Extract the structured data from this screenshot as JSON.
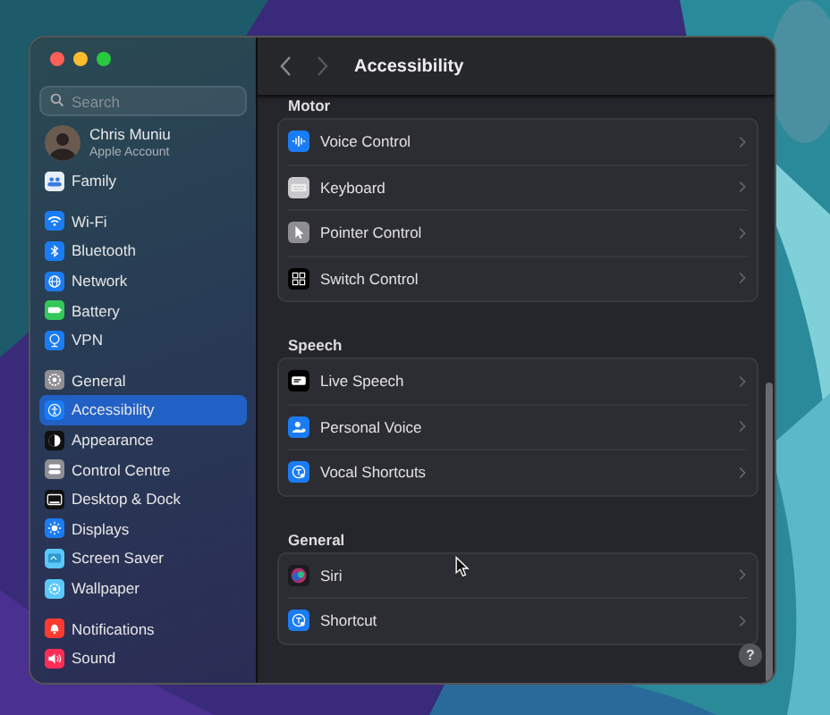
{
  "window": {
    "title": "Accessibility"
  },
  "sidebar": {
    "search": {
      "placeholder": "Search"
    },
    "account": {
      "name": "Chris Muniu",
      "subtitle": "Apple Account"
    },
    "groups": [
      {
        "items": [
          {
            "label": "Family",
            "selected": false
          }
        ]
      },
      {
        "items": [
          {
            "label": "Wi-Fi",
            "selected": false
          },
          {
            "label": "Bluetooth",
            "selected": false
          },
          {
            "label": "Network",
            "selected": false
          },
          {
            "label": "Battery",
            "selected": false
          },
          {
            "label": "VPN",
            "selected": false
          }
        ]
      },
      {
        "items": [
          {
            "label": "General",
            "selected": false
          },
          {
            "label": "Accessibility",
            "selected": true
          },
          {
            "label": "Appearance",
            "selected": false
          },
          {
            "label": "Control Centre",
            "selected": false
          },
          {
            "label": "Desktop & Dock",
            "selected": false
          },
          {
            "label": "Displays",
            "selected": false
          },
          {
            "label": "Screen Saver",
            "selected": false
          },
          {
            "label": "Wallpaper",
            "selected": false
          }
        ]
      },
      {
        "items": [
          {
            "label": "Notifications",
            "selected": false
          },
          {
            "label": "Sound",
            "selected": false
          }
        ]
      }
    ]
  },
  "content": {
    "sections": [
      {
        "title": "Motor",
        "items": [
          {
            "label": "Voice Control"
          },
          {
            "label": "Keyboard"
          },
          {
            "label": "Pointer Control"
          },
          {
            "label": "Switch Control"
          }
        ]
      },
      {
        "title": "Speech",
        "items": [
          {
            "label": "Live Speech"
          },
          {
            "label": "Personal Voice"
          },
          {
            "label": "Vocal Shortcuts"
          }
        ]
      },
      {
        "title": "General",
        "items": [
          {
            "label": "Siri"
          },
          {
            "label": "Shortcut"
          }
        ]
      }
    ],
    "help": "?"
  }
}
